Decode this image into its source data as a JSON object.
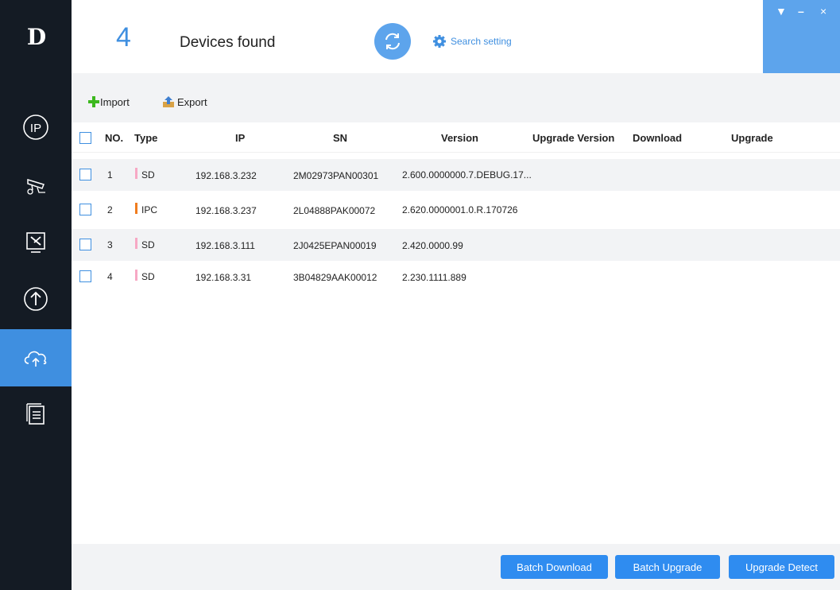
{
  "app": {
    "logo": "D",
    "window_controls": [
      "▼",
      "–",
      "×"
    ]
  },
  "sidebar": {
    "items": [
      {
        "name": "ip-icon"
      },
      {
        "name": "camera-config-icon"
      },
      {
        "name": "tools-icon"
      },
      {
        "name": "upgrade-icon"
      },
      {
        "name": "cloud-upgrade-icon",
        "active": true
      },
      {
        "name": "log-list-icon"
      }
    ]
  },
  "header": {
    "device_count": "4",
    "devices_found_label": "Devices found",
    "search_setting_label": "Search setting"
  },
  "toolbar": {
    "import_label": "Import",
    "export_label": "Export"
  },
  "table": {
    "headers": {
      "no": "NO.",
      "type": "Type",
      "ip": "IP",
      "sn": "SN",
      "version": "Version",
      "upgrade_version": "Upgrade Version",
      "download": "Download",
      "upgrade": "Upgrade"
    },
    "rows": [
      {
        "no": "1",
        "type": "SD",
        "type_color": "#f7a8c4",
        "ip": "192.168.3.232",
        "sn": "2M02973PAN00301",
        "version": "2.600.0000000.7.DEBUG.17..."
      },
      {
        "no": "2",
        "type": "IPC",
        "type_color": "#f07c1e",
        "ip": "192.168.3.237",
        "sn": "2L04888PAK00072",
        "version": "2.620.0000001.0.R.170726"
      },
      {
        "no": "3",
        "type": "SD",
        "type_color": "#f7a8c4",
        "ip": "192.168.3.111",
        "sn": "2J0425EPAN00019",
        "version": "2.420.0000.99"
      },
      {
        "no": "4",
        "type": "SD",
        "type_color": "#f7a8c4",
        "ip": "192.168.3.31",
        "sn": "3B04829AAK00012",
        "version": "2.230.1111.889"
      }
    ]
  },
  "footer": {
    "batch_download": "Batch Download",
    "batch_upgrade": "Batch Upgrade",
    "upgrade_detect": "Upgrade Detect"
  },
  "colors": {
    "accent": "#3f8fe0",
    "sidebar_bg": "#141b24",
    "button_bg": "#2f8cf0"
  }
}
